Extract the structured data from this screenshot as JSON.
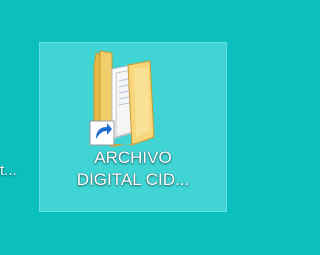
{
  "desktop": {
    "background_color": "#0ABFBE",
    "left_partial_label": "t...",
    "icon": {
      "type": "folder-shortcut",
      "label_line1": "ARCHIVO",
      "label_line2": "DIGITAL CID...",
      "selected": true
    }
  }
}
